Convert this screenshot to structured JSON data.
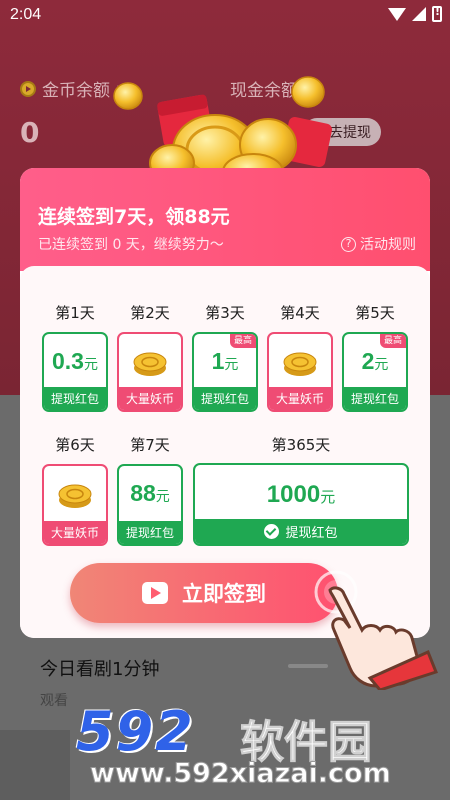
{
  "status_bar": {
    "time": "2:04"
  },
  "wallet": {
    "gold_label": "金币余额",
    "gold_arrow": "›",
    "gold_value": "0",
    "cash_label": "现金余额",
    "withdraw_label": "去提现"
  },
  "popup": {
    "title": "连续签到7天，领88元",
    "subtitle": "已连续签到 0 天，继续努力～",
    "rules_label": "活动规则",
    "days": [
      {
        "label": "第1天",
        "type": "cash",
        "amount": "0.3",
        "unit": "元",
        "footer": "提现红包",
        "badge": ""
      },
      {
        "label": "第2天",
        "type": "coins",
        "footer": "大量妖币",
        "badge": ""
      },
      {
        "label": "第3天",
        "type": "cash",
        "amount": "1",
        "unit": "元",
        "footer": "提现红包",
        "badge": "最高"
      },
      {
        "label": "第4天",
        "type": "coins",
        "footer": "大量妖币",
        "badge": ""
      },
      {
        "label": "第5天",
        "type": "cash",
        "amount": "2",
        "unit": "元",
        "footer": "提现红包",
        "badge": "最高"
      },
      {
        "label": "第6天",
        "type": "coins",
        "footer": "大量妖币",
        "badge": ""
      },
      {
        "label": "第7天",
        "type": "cash",
        "amount": "88",
        "unit": "元",
        "footer": "提现红包",
        "badge": ""
      }
    ],
    "grand": {
      "label": "第365天",
      "amount": "1000",
      "unit": "元",
      "footer": "提现红包"
    },
    "signin_button": "立即签到"
  },
  "task": {
    "title": "今日看剧1分钟",
    "subtitle": "观看"
  },
  "watermark": {
    "brand": "592",
    "brand_cn": "软件园",
    "url": "www.592xiazai.com"
  },
  "colors": {
    "accent_pink": "#ef4c74",
    "accent_green": "#1fa852",
    "header_pink": "#ff5e8a",
    "brand_blue": "#2f62e8"
  }
}
